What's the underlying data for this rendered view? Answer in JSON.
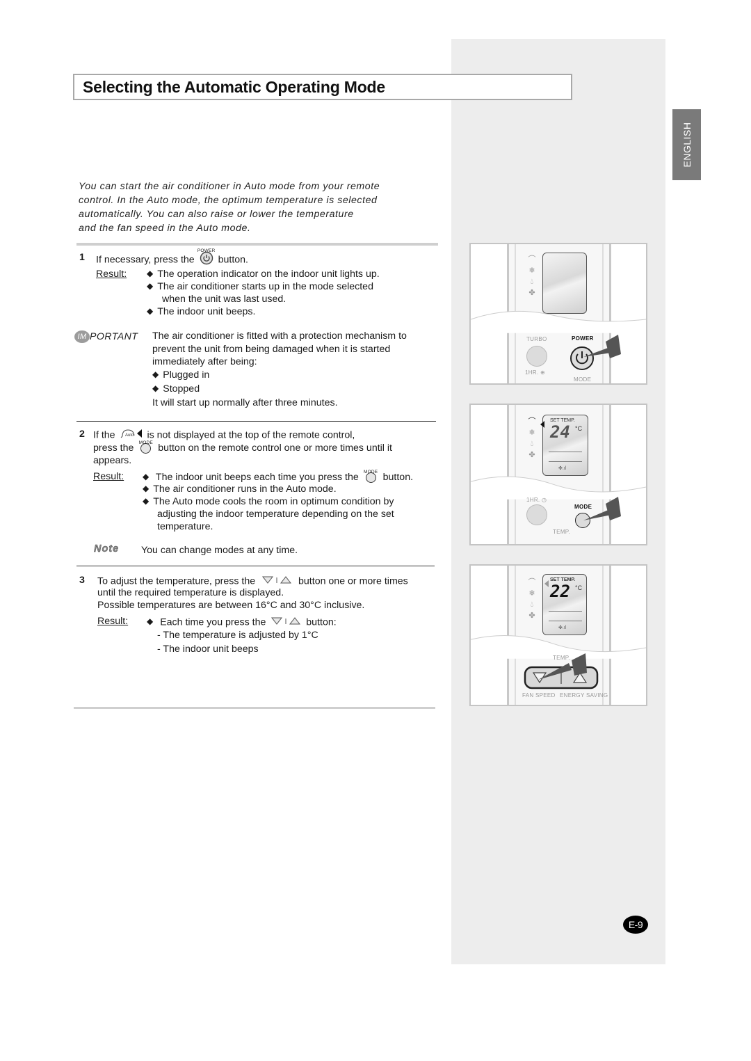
{
  "page": {
    "title": "Selecting the Automatic Operating Mode",
    "language_tab": "ENGLISH",
    "page_number": "E-9",
    "intro_lines": [
      "You can start the air conditioner in Auto mode from your remote",
      "control. In the Auto mode, the optimum temperature is selected",
      "automatically. You can also raise or lower the temperature",
      "and the fan speed in the Auto mode."
    ]
  },
  "steps": [
    {
      "number": "1",
      "text_before": "If necessary, press the",
      "button_caption": "POWER",
      "text_after": "button.",
      "result_label": "Result:",
      "results": [
        "The operation indicator on the indoor unit lights up.",
        "The air conditioner starts up in the mode selected",
        "The indoor unit beeps."
      ],
      "result_continuation": "when the unit was last used.",
      "important": {
        "badge_im": "IM",
        "badge_rest": "PORTANT",
        "lines": [
          "The air conditioner is fitted with a protection mechanism to",
          "prevent the unit from being damaged when it is started",
          "immediately after being:"
        ],
        "bullets": [
          "Plugged in",
          "Stopped"
        ],
        "closing": "It will start up normally after three minutes."
      }
    },
    {
      "number": "2",
      "line1_before": "If the",
      "auto_icon_label": "Auto",
      "line1_after": "is not displayed at the top of the remote control,",
      "line2_before": "press the",
      "button_caption": "MODE",
      "line2_after": "button on the remote control one or more times until it",
      "line3": "appears.",
      "result_label": "Result:",
      "result1_before": "The indoor unit beeps each time you press the",
      "result1_after": "button.",
      "result2": "The air conditioner runs in the Auto mode.",
      "result3_lines": [
        "The Auto mode cools the room in optimum condition by",
        "adjusting the indoor temperature depending on the set",
        "temperature."
      ],
      "note_label": "Note",
      "note_text": "You can change modes at any time."
    },
    {
      "number": "3",
      "line1_before": "To adjust the temperature, press the",
      "line1_after": "button one or more times",
      "line2": "until the required temperature is displayed.",
      "line3": "Possible temperatures are between 16°C and 30°C inclusive.",
      "result_label": "Result:",
      "result_before": "Each time you press the",
      "result_after": "button:",
      "sub_results": [
        "- The temperature is adjusted by 1°C",
        "- The indoor unit beeps"
      ]
    }
  ],
  "illustrations": [
    {
      "labels": {
        "turbo": "TURBO",
        "power": "POWER",
        "timer": "1HR. ⊕",
        "mode": "MODE"
      }
    },
    {
      "set_temp_label": "SET TEMP.",
      "temperature": "24",
      "unit": "°C",
      "labels": {
        "timer": "1HR. ◷",
        "mode": "MODE",
        "temp": "TEMP."
      }
    },
    {
      "set_temp_label": "SET TEMP.",
      "temperature": "22",
      "unit": "°C",
      "labels": {
        "temp": "TEMP.",
        "fan_speed": "FAN SPEED",
        "energy_saving": "ENERGY SAVING"
      }
    }
  ],
  "colors": {
    "sidebar": "#ededed",
    "language_tab": "#7a7a7a",
    "title_border": "#a8a8a8",
    "page_badge": "#000000"
  }
}
